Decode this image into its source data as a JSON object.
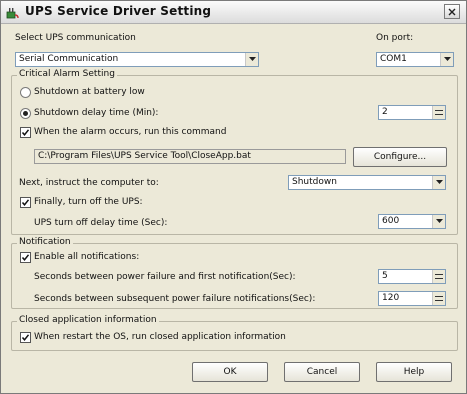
{
  "window": {
    "title": "UPS Service Driver Setting"
  },
  "top": {
    "select_label": "Select UPS communication",
    "select_value": "Serial Communication",
    "port_label": "On port:",
    "port_value": "COM1"
  },
  "critical": {
    "legend": "Critical Alarm Setting",
    "radio_battery_low": "Shutdown at battery low",
    "radio_delay": "Shutdown delay time (Min):",
    "delay_value": "2",
    "check_run_command": "When the alarm occurs, run this command",
    "command_path": "C:\\Program Files\\UPS Service Tool\\CloseApp.bat",
    "configure_button": "Configure...",
    "next_instruct_label": "Next, instruct the computer to:",
    "next_instruct_value": "Shutdown",
    "check_turn_off": "Finally, turn off the UPS:",
    "turn_off_delay_label": "UPS turn off delay time (Sec):",
    "turn_off_delay_value": "600"
  },
  "notification": {
    "legend": "Notification",
    "check_enable": "Enable all notifications:",
    "first_label": "Seconds between power failure and first notification(Sec):",
    "first_value": "5",
    "subsequent_label": "Seconds between subsequent power failure notifications(Sec):",
    "subsequent_value": "120"
  },
  "closed_app": {
    "legend": "Closed application information",
    "check_run_info": "When restart the OS, run closed application information"
  },
  "buttons": {
    "ok": "OK",
    "cancel": "Cancel",
    "help": "Help"
  },
  "state": {
    "selected_radio": "radio_delay",
    "checked": [
      "check_run_command",
      "check_turn_off",
      "check_enable",
      "check_run_info"
    ]
  },
  "icons": {
    "app": "ups-plug-icon",
    "close": "close-icon",
    "dropdown": "chevron-down-icon",
    "spinner": "spinner-icon",
    "check": "checkmark-icon"
  },
  "colors": {
    "dialog_background": "#ece9d8",
    "field_border": "#7f9db9"
  }
}
